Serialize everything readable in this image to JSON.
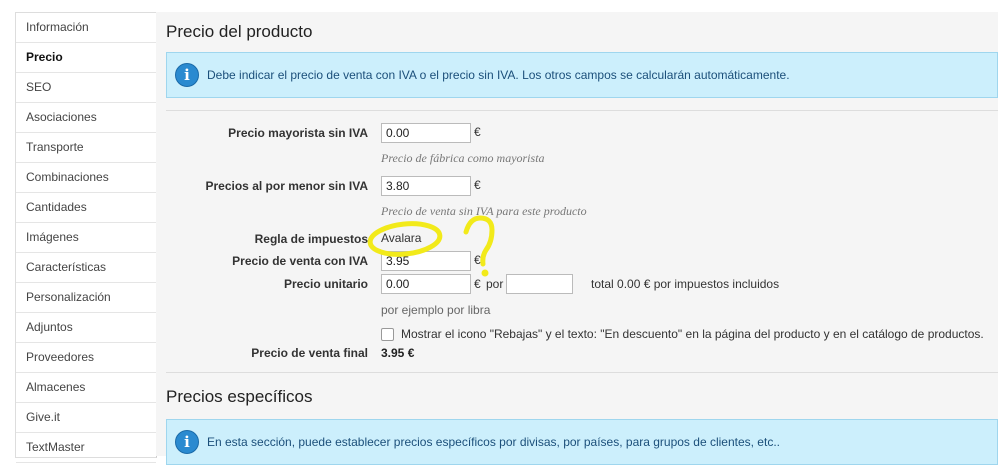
{
  "sidebar": {
    "items": [
      {
        "label": "Información"
      },
      {
        "label": "Precio",
        "active": true
      },
      {
        "label": "SEO"
      },
      {
        "label": "Asociaciones"
      },
      {
        "label": "Transporte"
      },
      {
        "label": "Combinaciones"
      },
      {
        "label": "Cantidades"
      },
      {
        "label": "Imágenes"
      },
      {
        "label": "Características"
      },
      {
        "label": "Personalización"
      },
      {
        "label": "Adjuntos"
      },
      {
        "label": "Proveedores"
      },
      {
        "label": "Almacenes"
      },
      {
        "label": "Give.it"
      },
      {
        "label": "TextMaster"
      }
    ]
  },
  "price_section": {
    "title": "Precio del producto",
    "info": "Debe indicar el precio de venta con IVA o el precio sin IVA. Los otros campos se calcularán automáticamente.",
    "wholesale": {
      "label": "Precio mayorista sin IVA",
      "value": "0.00",
      "currency": "€",
      "hint": "Precio de fábrica como mayorista"
    },
    "retail": {
      "label": "Precios al por menor sin IVA",
      "value": "3.80",
      "currency": "€",
      "hint": "Precio de venta sin IVA para este producto"
    },
    "tax_rule": {
      "label": "Regla de impuestos",
      "value": "Avalara"
    },
    "price_with_tax": {
      "label": "Precio de venta con IVA",
      "value": "3.95",
      "currency": "€"
    },
    "unit_price": {
      "label": "Precio unitario",
      "value": "0.00",
      "currency": "€",
      "per": "por",
      "unit_value": "",
      "total": "total 0.00 € por impuestos incluidos",
      "hint": "por ejemplo por libra"
    },
    "on_sale": {
      "label": "Mostrar el icono \"Rebajas\" y el texto: \"En descuento\" en la página del producto y en el catálogo de productos.",
      "checked": false
    },
    "final": {
      "label": "Precio de venta final",
      "value": "3.95 €"
    }
  },
  "specific_section": {
    "title": "Precios específicos",
    "info": "En esta sección, puede establecer precios específicos por divisas, por países, para grupos de clientes, etc.."
  },
  "annotation": {
    "color": "#f2ea1a",
    "mark": "?"
  }
}
